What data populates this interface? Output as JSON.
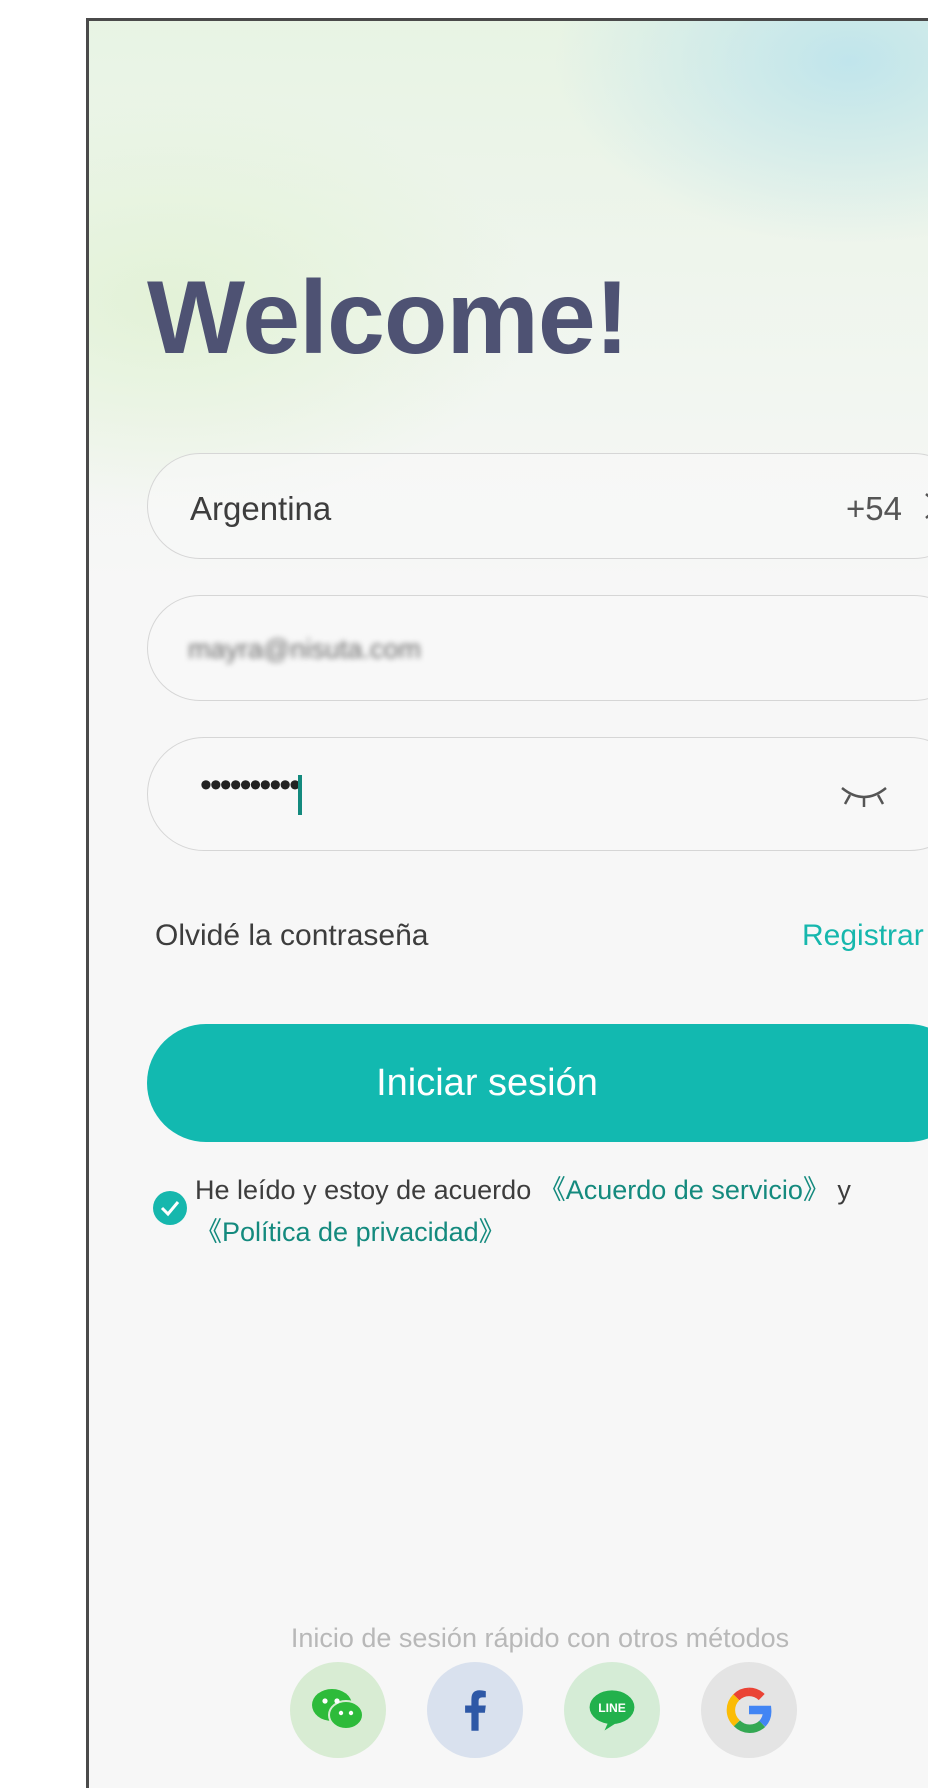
{
  "header": {
    "title": "Welcome!"
  },
  "country": {
    "name": "Argentina",
    "code": "+54"
  },
  "email": {
    "value": "mayra@nisuta.com"
  },
  "password": {
    "masked": "••••••••••"
  },
  "links": {
    "forgot": "Olvidé la contraseña",
    "register": "Registrar"
  },
  "login": {
    "label": "Iniciar sesión"
  },
  "agreement": {
    "prefix": "He leído y estoy de acuerdo ",
    "service": "《Acuerdo de servicio》",
    "conj": " y",
    "privacy": "《Política de privacidad》",
    "checked": true
  },
  "quick_login": {
    "label": "Inicio de sesión rápido con otros métodos",
    "methods": [
      {
        "name": "wechat-icon",
        "color": "#2dbb3a"
      },
      {
        "name": "facebook-icon",
        "color": "#3b5998"
      },
      {
        "name": "line-icon",
        "color": "#22b14c"
      },
      {
        "name": "google-icon",
        "color": "#4285f4"
      }
    ]
  },
  "colors": {
    "accent": "#12b9b0",
    "title": "#4e5273",
    "link_dark": "#148a7e"
  }
}
